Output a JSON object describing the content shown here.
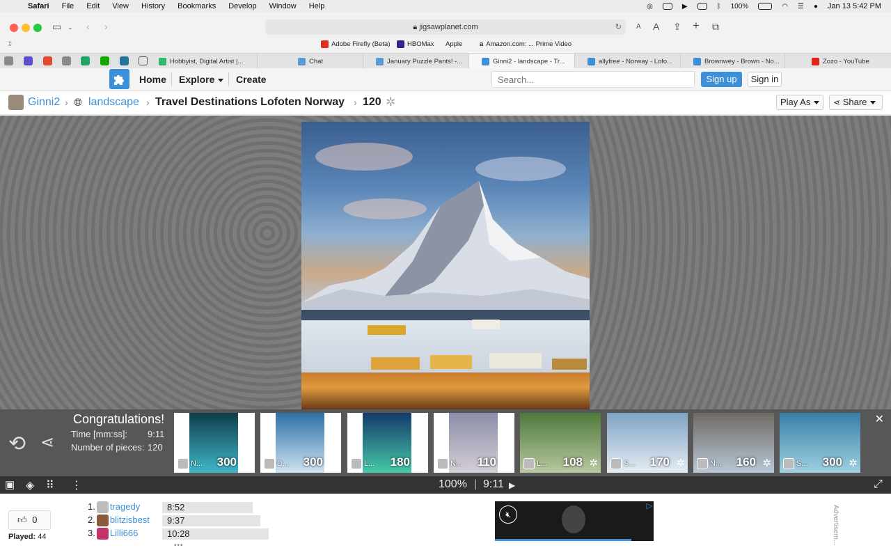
{
  "menubar": {
    "items": [
      "Safari",
      "File",
      "Edit",
      "View",
      "History",
      "Bookmarks",
      "Develop",
      "Window",
      "Help"
    ],
    "battery": "100%",
    "datetime": "Jan 13  5:42 PM"
  },
  "browser": {
    "url": "jigsawplanet.com",
    "favorites": [
      {
        "label": "Adobe Firefly (Beta)",
        "color": "#d9321f"
      },
      {
        "label": "HBOMax",
        "color": "#2b2a8a"
      },
      {
        "label": "Apple",
        "color": "#111111"
      },
      {
        "label": "Amazon.com: ... Prime Video",
        "color": "#111111"
      }
    ],
    "tabs": [
      {
        "label": "Hobbyist, Digital Artist |...",
        "color": "#33b86b"
      },
      {
        "label": "Chat",
        "color": "#5b9bd5"
      },
      {
        "label": "January Puzzle Pants! -...",
        "color": "#5b9bd5"
      },
      {
        "label": "Ginni2 - landscape - Tr...",
        "color": "#3d8fd8",
        "active": true
      },
      {
        "label": "allyfree - Norway - Lofo...",
        "color": "#3d8fd8"
      },
      {
        "label": "Brownwey - Brown - No...",
        "color": "#3d8fd8"
      },
      {
        "label": "Zozo - YouTube",
        "color": "#e62117"
      }
    ]
  },
  "site": {
    "nav": {
      "home": "Home",
      "explore": "Explore",
      "create": "Create"
    },
    "search_placeholder": "Search...",
    "signup": "Sign up",
    "signin": "Sign in"
  },
  "breadcrumb": {
    "user": "Ginni2",
    "category": "landscape",
    "title": "Travel Destinations Lofoten Norway",
    "pieces": "120",
    "play_as": "Play As",
    "share": "Share"
  },
  "completion": {
    "title": "Congratulations!",
    "time_label": "Time [mm:ss]:",
    "time_value": "9:11",
    "pieces_label": "Number of pieces:",
    "pieces_value": "120"
  },
  "suggestions": [
    {
      "name": "N...",
      "count": "300",
      "colors": [
        "#0f3d4a",
        "#3fb7c8"
      ]
    },
    {
      "name": "D...",
      "count": "300",
      "colors": [
        "#2f6fa6",
        "#cfe3f0"
      ]
    },
    {
      "name": "L...",
      "count": "180",
      "colors": [
        "#143a6b",
        "#46c9a8"
      ]
    },
    {
      "name": "N...",
      "count": "110",
      "colors": [
        "#8a8ea8",
        "#d5cfd6"
      ]
    },
    {
      "name": "L...",
      "count": "108",
      "colors": [
        "#4d7a3a",
        "#b9c7a0"
      ]
    },
    {
      "name": "S...",
      "count": "170",
      "colors": [
        "#7fa3c5",
        "#e5ecf2"
      ]
    },
    {
      "name": "N...",
      "count": "160",
      "colors": [
        "#6f6a62",
        "#b8c7d8"
      ]
    },
    {
      "name": "S...",
      "count": "300",
      "colors": [
        "#3a7fa8",
        "#9fd0e0"
      ]
    }
  ],
  "toolbar": {
    "zoom": "100%",
    "time": "9:11"
  },
  "footer": {
    "likes": "0",
    "played_label": "Played:",
    "played_count": "44",
    "leaderboard": [
      {
        "rank": "1.",
        "name": "tragedy",
        "time": "8:52",
        "avatar_color": "#bdbdbd"
      },
      {
        "rank": "2.",
        "name": "blitzisbest",
        "time": "9:37",
        "avatar_color": "#8a5a3c"
      },
      {
        "rank": "3.",
        "name": "Lilli666",
        "time": "10:28",
        "avatar_color": "#c0346a"
      }
    ],
    "more": "•••",
    "ad_label": "Advertisem..."
  }
}
